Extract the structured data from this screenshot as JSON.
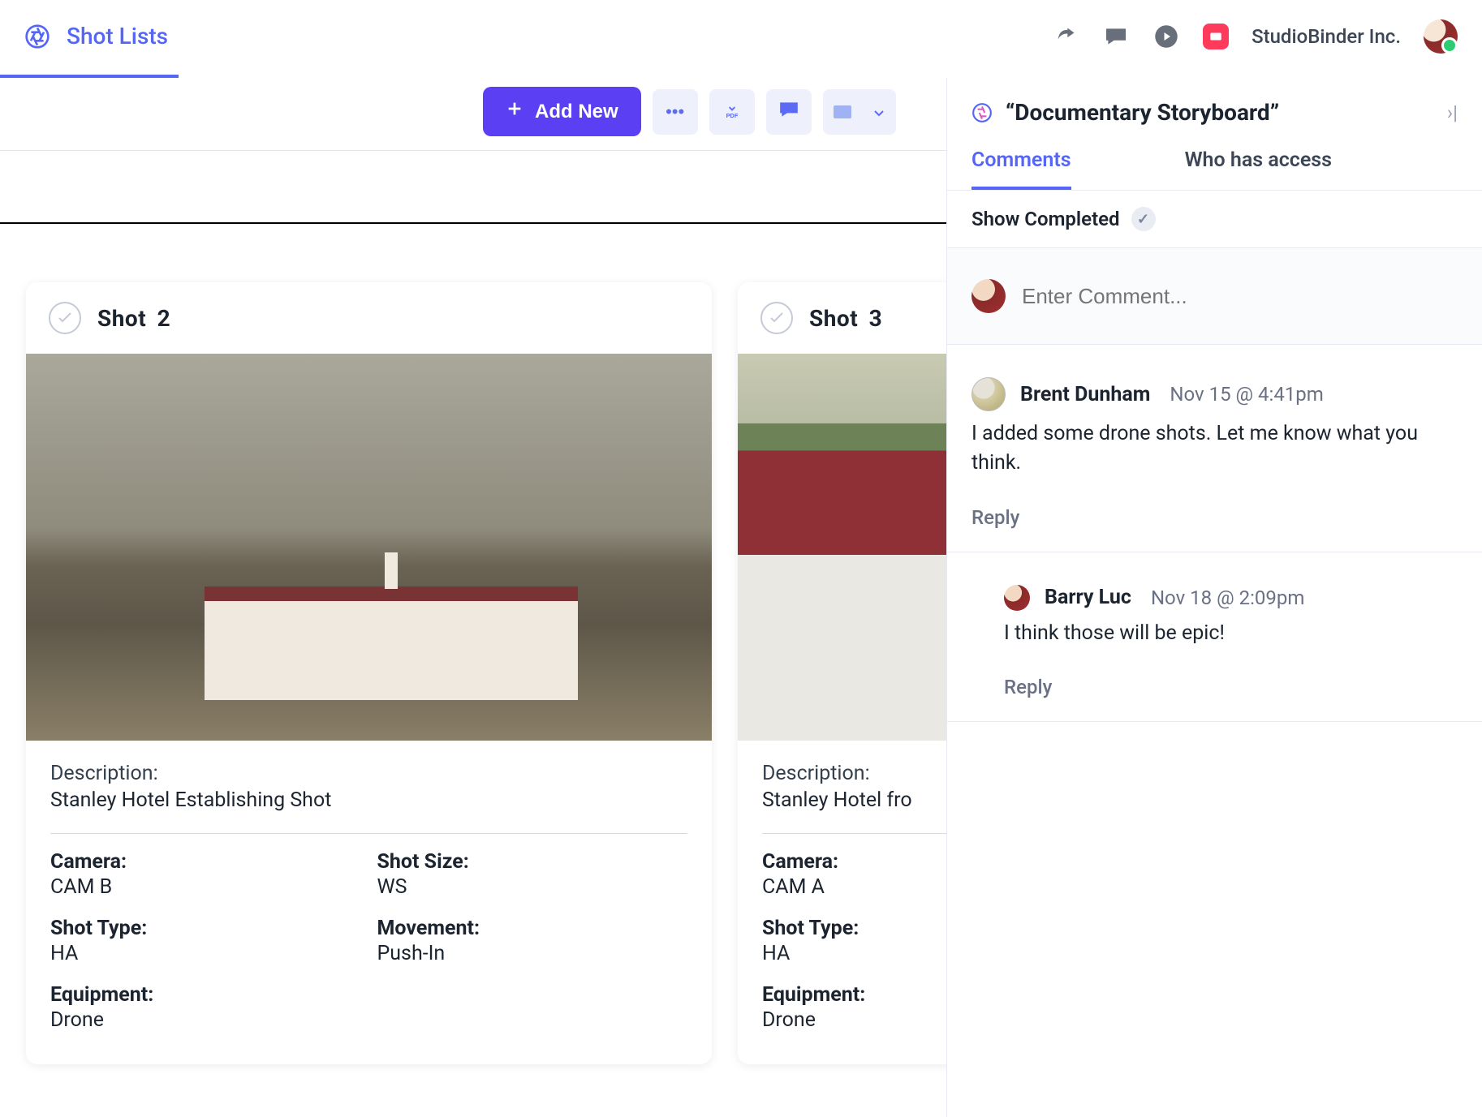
{
  "header": {
    "tab_label": "Shot Lists",
    "org_name": "StudioBinder Inc."
  },
  "toolbar": {
    "add_new_label": "Add New",
    "icons": {
      "more": "more-horizontal",
      "pdf": "download-pdf",
      "present": "present",
      "view_mode": "view-chevron"
    }
  },
  "shots": [
    {
      "label": "Shot",
      "number": "2",
      "description_label": "Description:",
      "description": "Stanley Hotel Establishing Shot",
      "meta": [
        {
          "label": "Camera:",
          "value": "CAM B"
        },
        {
          "label": "Shot Size:",
          "value": "WS"
        },
        {
          "label": "Shot Type:",
          "value": "HA"
        },
        {
          "label": "Movement:",
          "value": "Push-In"
        },
        {
          "label": "Equipment:",
          "value": "Drone"
        }
      ]
    },
    {
      "label": "Shot",
      "number": "3",
      "description_label": "Description:",
      "description": "Stanley Hotel fro",
      "meta": [
        {
          "label": "Camera:",
          "value": "CAM A"
        },
        {
          "label": "Shot Type:",
          "value": "HA"
        },
        {
          "label": "Equipment:",
          "value": "Drone"
        }
      ]
    }
  ],
  "panel": {
    "title": "“Documentary Storyboard”",
    "tabs": {
      "comments": "Comments",
      "access": "Who has access"
    },
    "show_completed": "Show Completed",
    "comment_placeholder": "Enter Comment...",
    "comments": [
      {
        "name": "Brent Dunham",
        "time": "Nov 15 @ 4:41pm",
        "body": "I added some drone shots. Let me know what you think.",
        "reply": "Reply"
      },
      {
        "name": "Barry Luc",
        "time": "Nov 18 @ 2:09pm",
        "body": "I think those will be epic!",
        "reply": "Reply",
        "nested": true
      }
    ]
  }
}
